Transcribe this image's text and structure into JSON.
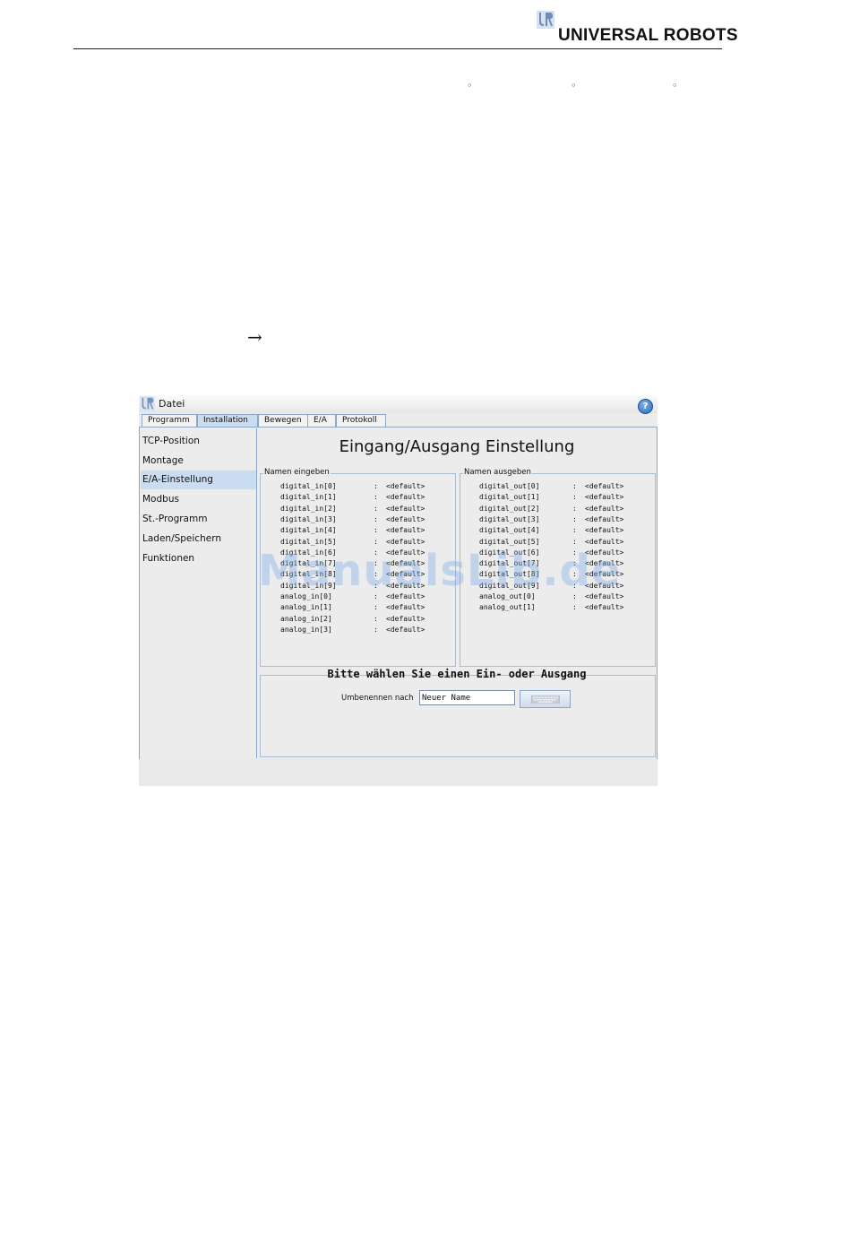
{
  "header": {
    "brand": "UNIVERSAL ROBOTS",
    "logo_icon": "ur-logo-icon",
    "degree_marks": [
      "◦",
      "◦",
      "◦"
    ],
    "arrow": "→"
  },
  "app": {
    "title_menu": "Datei",
    "help_icon": "help-icon",
    "help_symbol": "?",
    "tabs": [
      {
        "label": "Programm",
        "active": false
      },
      {
        "label": "Installation",
        "active": true
      },
      {
        "label": "Bewegen",
        "active": false
      },
      {
        "label": "E/A",
        "active": false
      },
      {
        "label": "Protokoll",
        "active": false
      }
    ],
    "sidebar": [
      {
        "label": "TCP-Position",
        "selected": false
      },
      {
        "label": "Montage",
        "selected": false
      },
      {
        "label": "E/A-Einstellung",
        "selected": true
      },
      {
        "label": "Modbus",
        "selected": false
      },
      {
        "label": "St.-Programm",
        "selected": false
      },
      {
        "label": "Laden/Speichern",
        "selected": false
      },
      {
        "label": "Funktionen",
        "selected": false
      }
    ],
    "heading": "Eingang/Ausgang Einstellung",
    "inputs": {
      "title": "Namen eingeben",
      "rows": [
        {
          "name": "digital_in[0]",
          "sep": ":",
          "value": "<default>"
        },
        {
          "name": "digital_in[1]",
          "sep": ":",
          "value": "<default>"
        },
        {
          "name": "digital_in[2]",
          "sep": ":",
          "value": "<default>"
        },
        {
          "name": "digital_in[3]",
          "sep": ":",
          "value": "<default>"
        },
        {
          "name": "digital_in[4]",
          "sep": ":",
          "value": "<default>"
        },
        {
          "name": "digital_in[5]",
          "sep": ":",
          "value": "<default>"
        },
        {
          "name": "digital_in[6]",
          "sep": ":",
          "value": "<default>"
        },
        {
          "name": "digital_in[7]",
          "sep": ":",
          "value": "<default>"
        },
        {
          "name": "digital_in[8]",
          "sep": ":",
          "value": "<default>"
        },
        {
          "name": "digital_in[9]",
          "sep": ":",
          "value": "<default>"
        },
        {
          "name": "analog_in[0]",
          "sep": ":",
          "value": "<default>"
        },
        {
          "name": "analog_in[1]",
          "sep": ":",
          "value": "<default>"
        },
        {
          "name": "analog_in[2]",
          "sep": ":",
          "value": "<default>"
        },
        {
          "name": "analog_in[3]",
          "sep": ":",
          "value": "<default>"
        }
      ]
    },
    "outputs": {
      "title": "Namen ausgeben",
      "rows": [
        {
          "name": "digital_out[0]",
          "sep": ":",
          "value": "<default>"
        },
        {
          "name": "digital_out[1]",
          "sep": ":",
          "value": "<default>"
        },
        {
          "name": "digital_out[2]",
          "sep": ":",
          "value": "<default>"
        },
        {
          "name": "digital_out[3]",
          "sep": ":",
          "value": "<default>"
        },
        {
          "name": "digital_out[4]",
          "sep": ":",
          "value": "<default>"
        },
        {
          "name": "digital_out[5]",
          "sep": ":",
          "value": "<default>"
        },
        {
          "name": "digital_out[6]",
          "sep": ":",
          "value": "<default>"
        },
        {
          "name": "digital_out[7]",
          "sep": ":",
          "value": "<default>"
        },
        {
          "name": "digital_out[8]",
          "sep": ":",
          "value": "<default>"
        },
        {
          "name": "digital_out[9]",
          "sep": ":",
          "value": "<default>"
        },
        {
          "name": "analog_out[0]",
          "sep": ":",
          "value": "<default>"
        },
        {
          "name": "analog_out[1]",
          "sep": ":",
          "value": "<default>"
        }
      ]
    },
    "select_prompt": "Bitte wählen Sie einen Ein- oder Ausgang",
    "rename_label": "Umbenennen nach",
    "rename_value": "Neuer Name",
    "keyboard_icon": "keyboard-icon"
  },
  "watermark": "ManualsLib.de"
}
